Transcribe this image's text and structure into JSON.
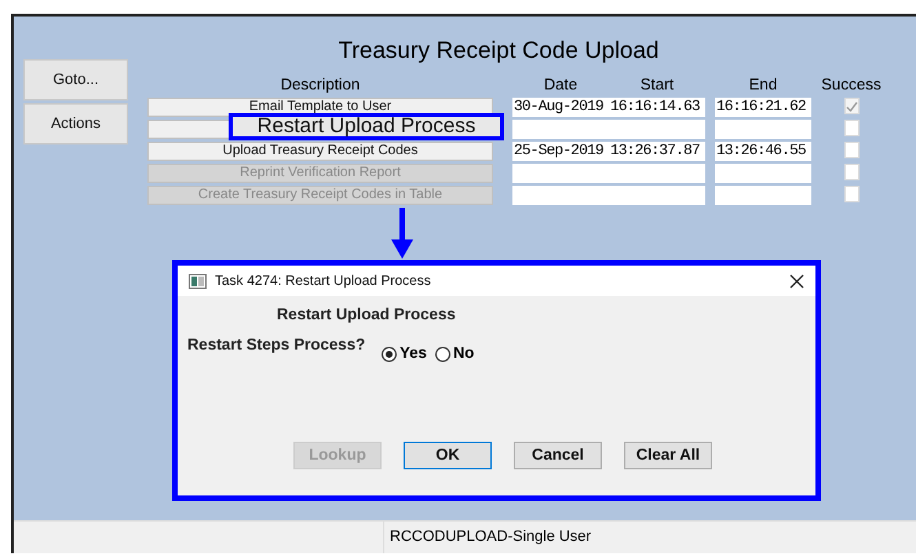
{
  "window": {
    "title": "Treasury Receipt Code Upload"
  },
  "nav_buttons": [
    "Goto...",
    "Actions"
  ],
  "columns": [
    "Description",
    "Date",
    "Start",
    "End",
    "Success"
  ],
  "steps": [
    {
      "description": "Email Template to User",
      "disabled": false,
      "date": "30-Aug-2019",
      "start": "16:16:14.63",
      "end": "16:16:21.62",
      "success": true
    },
    {
      "disabled": false,
      "success": false
    },
    {
      "description": "Upload Treasury Receipt Codes",
      "disabled": false,
      "date": "25-Sep-2019",
      "start": "13:26:37.87",
      "end": "13:26:46.55",
      "success": false
    },
    {
      "description": "Reprint Verification Report",
      "disabled": true,
      "success": false
    },
    {
      "description": "Create Treasury Receipt Codes in Table",
      "disabled": true,
      "success": false
    }
  ],
  "callout": {
    "text": "Restart Upload Process"
  },
  "dialog": {
    "title": "Task 4274: Restart Upload Process",
    "heading": "Restart Upload Process",
    "question": "Restart Steps Process?",
    "options": [
      {
        "label": "Yes",
        "selected": true
      },
      {
        "label": "No",
        "selected": false
      }
    ],
    "buttons": [
      {
        "label": "Lookup",
        "disabled": true,
        "default": false
      },
      {
        "label": "OK",
        "disabled": false,
        "default": true
      },
      {
        "label": "Cancel",
        "disabled": false,
        "default": false
      },
      {
        "label": "Clear All",
        "disabled": false,
        "default": false
      }
    ]
  },
  "status_bar": {
    "text": "RCCODUPLOAD-Single User"
  }
}
